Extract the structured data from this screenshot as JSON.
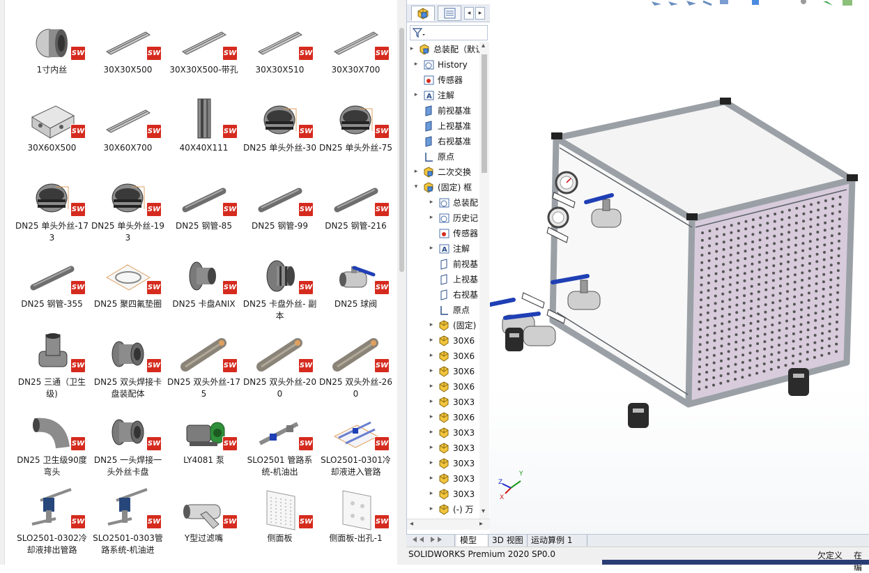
{
  "explorer": {
    "files": [
      {
        "label": "1寸内丝",
        "icon": "pipe-fitting-thumb"
      },
      {
        "label": "30X30X500",
        "icon": "aluminum-profile-thumb"
      },
      {
        "label": "30X30X500-带孔",
        "icon": "aluminum-profile-thumb"
      },
      {
        "label": "30X30X510",
        "icon": "aluminum-profile-thumb"
      },
      {
        "label": "30X30X700",
        "icon": "aluminum-profile-thumb"
      },
      {
        "label": "30X60X500",
        "icon": "profile-section-thumb"
      },
      {
        "label": "30X60X700",
        "icon": "aluminum-profile-thumb"
      },
      {
        "label": "40X40X111",
        "icon": "profile-post-thumb"
      },
      {
        "label": "DN25 单头外丝-30",
        "icon": "threaded-fitting-thumb"
      },
      {
        "label": "DN25 单头外丝-75",
        "icon": "threaded-fitting-thumb"
      },
      {
        "label": "DN25 单头外丝-173",
        "icon": "threaded-fitting-thumb"
      },
      {
        "label": "DN25 单头外丝-193",
        "icon": "threaded-fitting-thumb"
      },
      {
        "label": "DN25 钢管-85",
        "icon": "steel-pipe-thumb"
      },
      {
        "label": "DN25 钢管-99",
        "icon": "steel-pipe-thumb"
      },
      {
        "label": "DN25 钢管-216",
        "icon": "steel-pipe-thumb"
      },
      {
        "label": "DN25 钢管-355",
        "icon": "steel-pipe-thumb"
      },
      {
        "label": "DN25 聚四氟垫圈",
        "icon": "gasket-thumb"
      },
      {
        "label": "DN25 卡盘ANIX",
        "icon": "clamp-flange-thumb"
      },
      {
        "label": "DN25 卡盘外丝- 副本",
        "icon": "clamp-threaded-thumb"
      },
      {
        "label": "DN25 球阀",
        "icon": "ball-valve-thumb"
      },
      {
        "label": "DN25 三通（卫生级)",
        "icon": "tee-thumb"
      },
      {
        "label": "DN25 双头焊接卡盘装配体",
        "icon": "double-ferrule-thumb"
      },
      {
        "label": "DN25 双头外丝-175",
        "icon": "threaded-pipe-thumb"
      },
      {
        "label": "DN25 双头外丝-200",
        "icon": "threaded-pipe-thumb"
      },
      {
        "label": "DN25 双头外丝-260",
        "icon": "threaded-pipe-thumb"
      },
      {
        "label": "DN25 卫生级90度弯头",
        "icon": "elbow-thumb"
      },
      {
        "label": "DN25 一头焊接一头外丝卡盘",
        "icon": "double-ferrule-thumb"
      },
      {
        "label": "LY4081 泵",
        "icon": "pump-thumb"
      },
      {
        "label": "SLO2501 管路系统-机油出",
        "icon": "pipe-system-thumb"
      },
      {
        "label": "SLO2501-0301冷却液进入管路",
        "icon": "pipe-assembly-thumb"
      },
      {
        "label": "SLO2501-0302冷却液排出管路",
        "icon": "pipe-system-blue-thumb"
      },
      {
        "label": "SLO2501-0303管路系统-机油进",
        "icon": "pipe-system-blue-thumb"
      },
      {
        "label": "Y型过滤嘴",
        "icon": "y-strainer-thumb"
      },
      {
        "label": "侧面板",
        "icon": "panel-thumb"
      },
      {
        "label": "侧面板-出孔-1",
        "icon": "panel-holes-thumb"
      }
    ],
    "badge_text": "SW",
    "badge_color": "#d52b1e"
  },
  "feature_manager": {
    "tree": [
      {
        "label": "总装配（默认",
        "icon": "assembly-icon",
        "indent": 0,
        "toggle": "▸"
      },
      {
        "label": "History",
        "icon": "history-icon",
        "indent": 1,
        "toggle": "▸"
      },
      {
        "label": "传感器",
        "icon": "sensor-icon",
        "indent": 1,
        "toggle": ""
      },
      {
        "label": "注解",
        "icon": "annotation-icon",
        "indent": 1,
        "toggle": "▸"
      },
      {
        "label": "前视基准",
        "icon": "plane-icon",
        "indent": 1,
        "toggle": ""
      },
      {
        "label": "上视基准",
        "icon": "plane-icon",
        "indent": 1,
        "toggle": ""
      },
      {
        "label": "右视基准",
        "icon": "plane-icon",
        "indent": 1,
        "toggle": ""
      },
      {
        "label": "原点",
        "icon": "origin-icon",
        "indent": 1,
        "toggle": ""
      },
      {
        "label": "二次交换",
        "icon": "assembly-icon",
        "indent": 1,
        "toggle": "▸"
      },
      {
        "label": "(固定) 框",
        "icon": "assembly-icon",
        "indent": 1,
        "toggle": "▾"
      },
      {
        "label": "总装配",
        "icon": "history-icon",
        "indent": 2,
        "toggle": "▸"
      },
      {
        "label": "历史记",
        "icon": "history-icon",
        "indent": 2,
        "toggle": "▸"
      },
      {
        "label": "传感器",
        "icon": "sensor-icon",
        "indent": 2,
        "toggle": ""
      },
      {
        "label": "注解",
        "icon": "annotation-icon",
        "indent": 2,
        "toggle": "▸"
      },
      {
        "label": "前视基",
        "icon": "plane-outline-icon",
        "indent": 2,
        "toggle": ""
      },
      {
        "label": "上视基",
        "icon": "plane-outline-icon",
        "indent": 2,
        "toggle": ""
      },
      {
        "label": "右视基",
        "icon": "plane-outline-icon",
        "indent": 2,
        "toggle": ""
      },
      {
        "label": "原点",
        "icon": "origin-icon",
        "indent": 2,
        "toggle": ""
      },
      {
        "label": "(固定)",
        "icon": "part-icon",
        "indent": 2,
        "toggle": "▸"
      },
      {
        "label": "30X6",
        "icon": "part-icon",
        "indent": 2,
        "toggle": "▸"
      },
      {
        "label": "30X6",
        "icon": "part-icon",
        "indent": 2,
        "toggle": "▸"
      },
      {
        "label": "30X6",
        "icon": "part-icon",
        "indent": 2,
        "toggle": "▸"
      },
      {
        "label": "30X6",
        "icon": "part-icon",
        "indent": 2,
        "toggle": "▸"
      },
      {
        "label": "30X3",
        "icon": "part-icon",
        "indent": 2,
        "toggle": "▸"
      },
      {
        "label": "30X6",
        "icon": "part-icon",
        "indent": 2,
        "toggle": "▸"
      },
      {
        "label": "30X3",
        "icon": "part-icon",
        "indent": 2,
        "toggle": "▸"
      },
      {
        "label": "30X3",
        "icon": "part-icon",
        "indent": 2,
        "toggle": "▸"
      },
      {
        "label": "30X3",
        "icon": "part-icon",
        "indent": 2,
        "toggle": "▸"
      },
      {
        "label": "30X3",
        "icon": "part-icon",
        "indent": 2,
        "toggle": "▸"
      },
      {
        "label": "30X3",
        "icon": "part-icon",
        "indent": 2,
        "toggle": "▸"
      },
      {
        "label": "(-) 万",
        "icon": "part-icon",
        "indent": 2,
        "toggle": "▸"
      }
    ]
  },
  "viewport": {
    "model": "cabinet-assembly",
    "panel_color": "#cdbfd3",
    "triad_x": "X",
    "triad_y": "Y",
    "triad_z": "Z"
  },
  "bottom_tabs": [
    "",
    "模型",
    "3D 视图",
    "运动算例 1"
  ],
  "status": {
    "product": "SOLIDWORKS Premium 2020 SP0.0",
    "state": "欠定义",
    "mode": "在编"
  }
}
